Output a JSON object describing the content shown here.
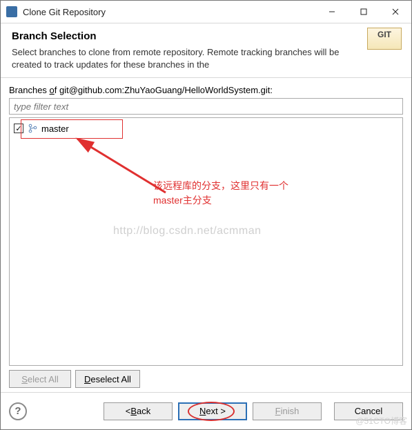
{
  "titlebar": {
    "title": "Clone Git Repository"
  },
  "header": {
    "heading": "Branch Selection",
    "description": "Select branches to clone from remote repository. Remote tracking branches will be created to track updates for these branches in the"
  },
  "branches": {
    "label_prefix": "Branches ",
    "label_of": "o",
    "label_suffix": "f git@github.com:ZhuYaoGuang/HelloWorldSystem.git:",
    "filter_placeholder": "type filter text",
    "items": [
      {
        "checked": true,
        "name": "master"
      }
    ]
  },
  "selection_buttons": {
    "select_all_pre": "S",
    "select_all_post": "elect All",
    "deselect_all_pre": "D",
    "deselect_all_post": "eselect All"
  },
  "annotation": {
    "line1": "该远程库的分支，这里只有一个",
    "line2": "master主分支"
  },
  "watermark": "http://blog.csdn.net/acmman",
  "corner_watermark": "@51CTO博客",
  "footer": {
    "back_pre": "< ",
    "back_u": "B",
    "back_post": "ack",
    "next_u": "N",
    "next_post": "ext >",
    "finish_u": "F",
    "finish_post": "inish",
    "cancel": "Cancel"
  }
}
